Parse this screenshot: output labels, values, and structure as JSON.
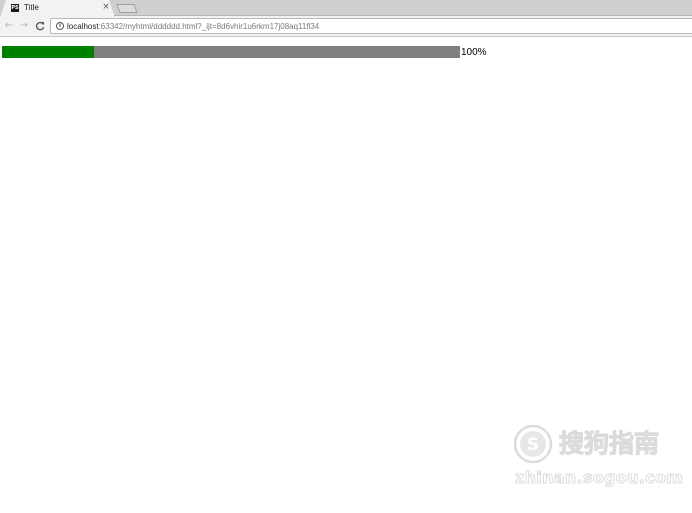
{
  "tab": {
    "favicon_text": "PS",
    "title": "Title",
    "close_glyph": "×"
  },
  "toolbar": {
    "back_glyph": "←",
    "forward_glyph": "→",
    "reload_glyph": "C",
    "url_host": "localhost",
    "url_rest": ":63342/myhtml/dddddd.html?_ijt=8d6vhir1u6rkm17j08aq11fl34"
  },
  "progress": {
    "fill_fraction": 0.2,
    "label": "100%",
    "fill_color": "#008000",
    "track_color": "#808080"
  },
  "watermark": {
    "name": "搜狗指南",
    "domain": "zhinan.sogou.com"
  },
  "icons": {
    "favicon": "app-favicon",
    "close": "close-icon",
    "back": "back-arrow-icon",
    "forward": "forward-arrow-icon",
    "reload": "reload-icon",
    "info": "info-icon",
    "watermark_logo": "sogou-logo-icon"
  }
}
